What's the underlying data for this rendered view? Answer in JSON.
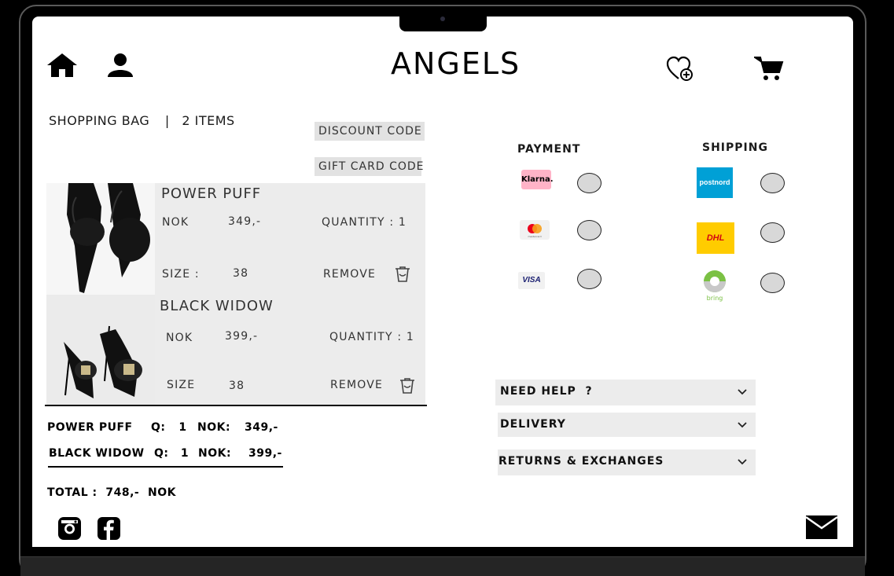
{
  "brand": "ANGELS",
  "bag": {
    "title": "SHOPPING BAG",
    "separator": "|",
    "count": "2 ITEMS",
    "discount_label": "DISCOUNT CODE",
    "giftcard_label": "GIFT CARD CODE"
  },
  "items": [
    {
      "name": "POWER PUFF",
      "currency": "NOK",
      "price": "349,-",
      "quantity_label": "QUANTITY : 1",
      "size_label": "SIZE :",
      "size": "38",
      "remove_label": "REMOVE"
    },
    {
      "name": "BLACK WIDOW",
      "currency": "NOK",
      "price": "399,-",
      "quantity_label": "QUANTITY : 1",
      "size_label": "SIZE",
      "size": "38",
      "remove_label": "REMOVE"
    }
  ],
  "summary": {
    "rows": [
      {
        "name": "POWER PUFF",
        "q_label": "Q:",
        "q": "1",
        "cur": "NOK:",
        "price": "349,-"
      },
      {
        "name": "BLACK WIDOW",
        "q_label": "Q:",
        "q": "1",
        "cur": "NOK:",
        "price": "399,-"
      }
    ],
    "total": "TOTAL :  748,-  NOK"
  },
  "payment": {
    "title": "PAYMENT",
    "options": [
      {
        "name": "Klarna.",
        "icon": "klarna-logo"
      },
      {
        "name": "mastercard",
        "icon": "mastercard-logo"
      },
      {
        "name": "VISA",
        "icon": "visa-logo"
      }
    ]
  },
  "shipping": {
    "title": "SHIPPING",
    "options": [
      {
        "name": "postnord",
        "icon": "postnord-logo"
      },
      {
        "name": "DHL",
        "icon": "dhl-logo"
      },
      {
        "name": "bring",
        "icon": "bring-logo"
      }
    ]
  },
  "help": [
    {
      "label": "NEED HELP  ?"
    },
    {
      "label": "DELIVERY"
    },
    {
      "label": "RETURNS & EXCHANGES"
    }
  ],
  "colors": {
    "klarna": "#ffb3c7",
    "postnord": "#00a0d6",
    "dhl": "#ffcc00",
    "dhl_red": "#d40511",
    "bring": "#7bc144",
    "panel": "#ececec"
  }
}
